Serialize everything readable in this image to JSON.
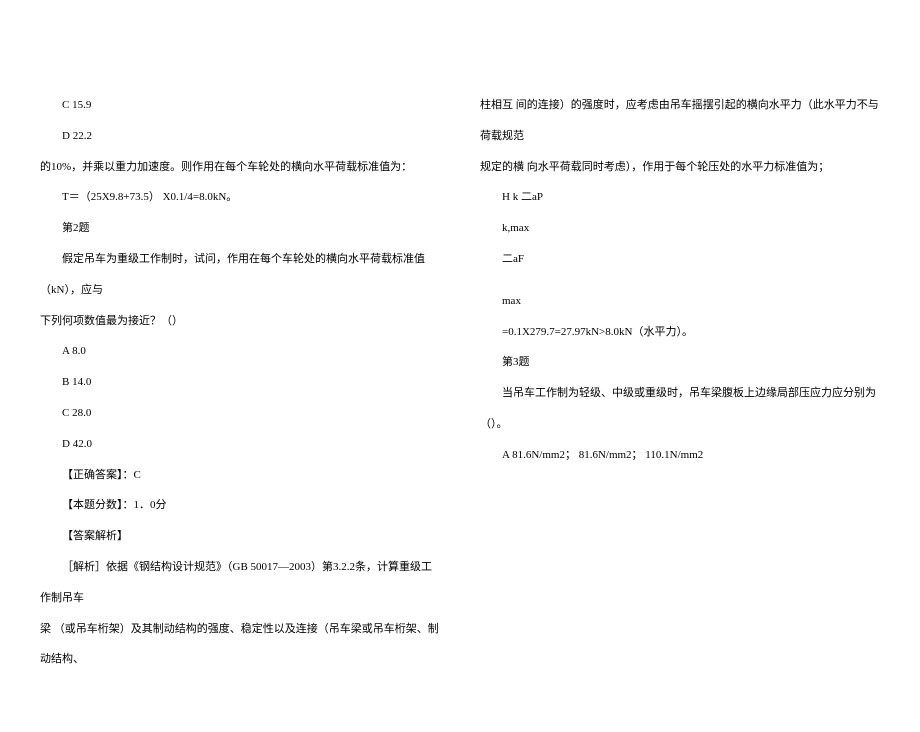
{
  "left": {
    "optC": "C 15.9",
    "optD": "D 22.2",
    "l1": "的10%，并乘以重力加速度。则作用在每个车轮处的横向水平荷载标准值为：",
    "l2": "T＝（25X9.8+73.5） X0.1/4=8.0kN。",
    "q2_label": "第2题",
    "q2_text_a": "假定吊车为重级工作制时，试问，作用在每个车轮处的横向水平荷载标准值（kN），应与",
    "q2_text_b": "下列何项数值最为接近？（）",
    "q2_optA": "A 8.0",
    "q2_optB": "B 14.0",
    "q2_optC": "C 28.0",
    "q2_optD": "D 42.0",
    "answer": "【正确答案】：C",
    "score": "【本题分数】：1．0分"
  },
  "right": {
    "expl_label": "【答案解析】",
    "expl_1": "［解析］依据《钢结构设计规范》（GB 50017—2003）第3.2.2条，计算重级工作制吊车",
    "expl_2": "梁 （或吊车桁架）及其制动结构的强度、稳定性以及连接（吊车梁或吊车桁架、制动结构、",
    "expl_3": "柱相互 间的连接）的强度时，应考虑由吊车摇摆引起的横向水平力（此水平力不与荷载规范",
    "expl_4": "规定的横 向水平荷载同时考虑），作用于每个轮压处的水平力标准值为；",
    "f1": "H k 二aP",
    "f2": "k,max",
    "f3": "二aF",
    "f4": "max",
    "f5": "=0.1X279.7=27.97kN>8.0kN（水平力）。",
    "q3_label": "第3题",
    "q3_text": "当吊车工作制为轻级、中级或重级时，吊车梁腹板上边缘局部压应力应分别为（）。",
    "q3_optA": "A 81.6N/mm2； 81.6N/mm2； 110.1N/mm2"
  }
}
